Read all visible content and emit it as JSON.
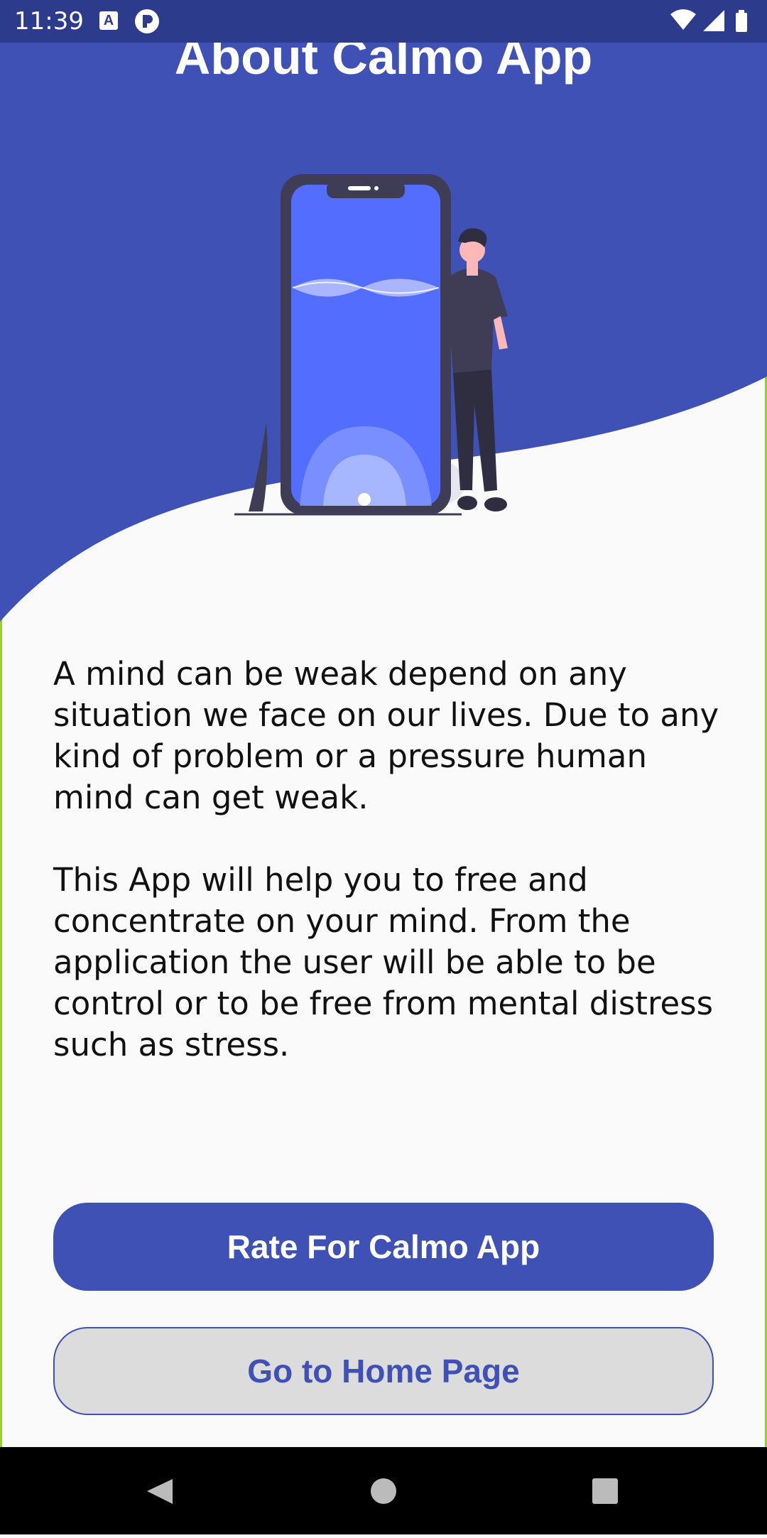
{
  "status_bar": {
    "time": "11:39",
    "a_icon_text": "A"
  },
  "page": {
    "title": "About Calmo App",
    "paragraphs": [
      "A mind can be weak depend on any situation we face on our lives. Due to any kind of problem or a pressure human mind can get weak.",
      "This App will help you to free and concentrate on your mind. From the application the user will be able to be control or to be free from mental distress such as stress."
    ]
  },
  "buttons": {
    "rate_label": "Rate For Calmo App",
    "home_label": "Go to Home Page"
  },
  "colors": {
    "primary": "#3f51b5",
    "status_bar": "#2d3b8c",
    "background": "#fafafa",
    "secondary_button": "#dcdcdc"
  },
  "icons": {
    "status_left": [
      "notification-a-icon",
      "notification-p-icon"
    ],
    "status_right": [
      "wifi-icon",
      "signal-icon",
      "battery-icon"
    ],
    "navigation": [
      "back-icon",
      "home-icon",
      "recents-icon"
    ]
  }
}
